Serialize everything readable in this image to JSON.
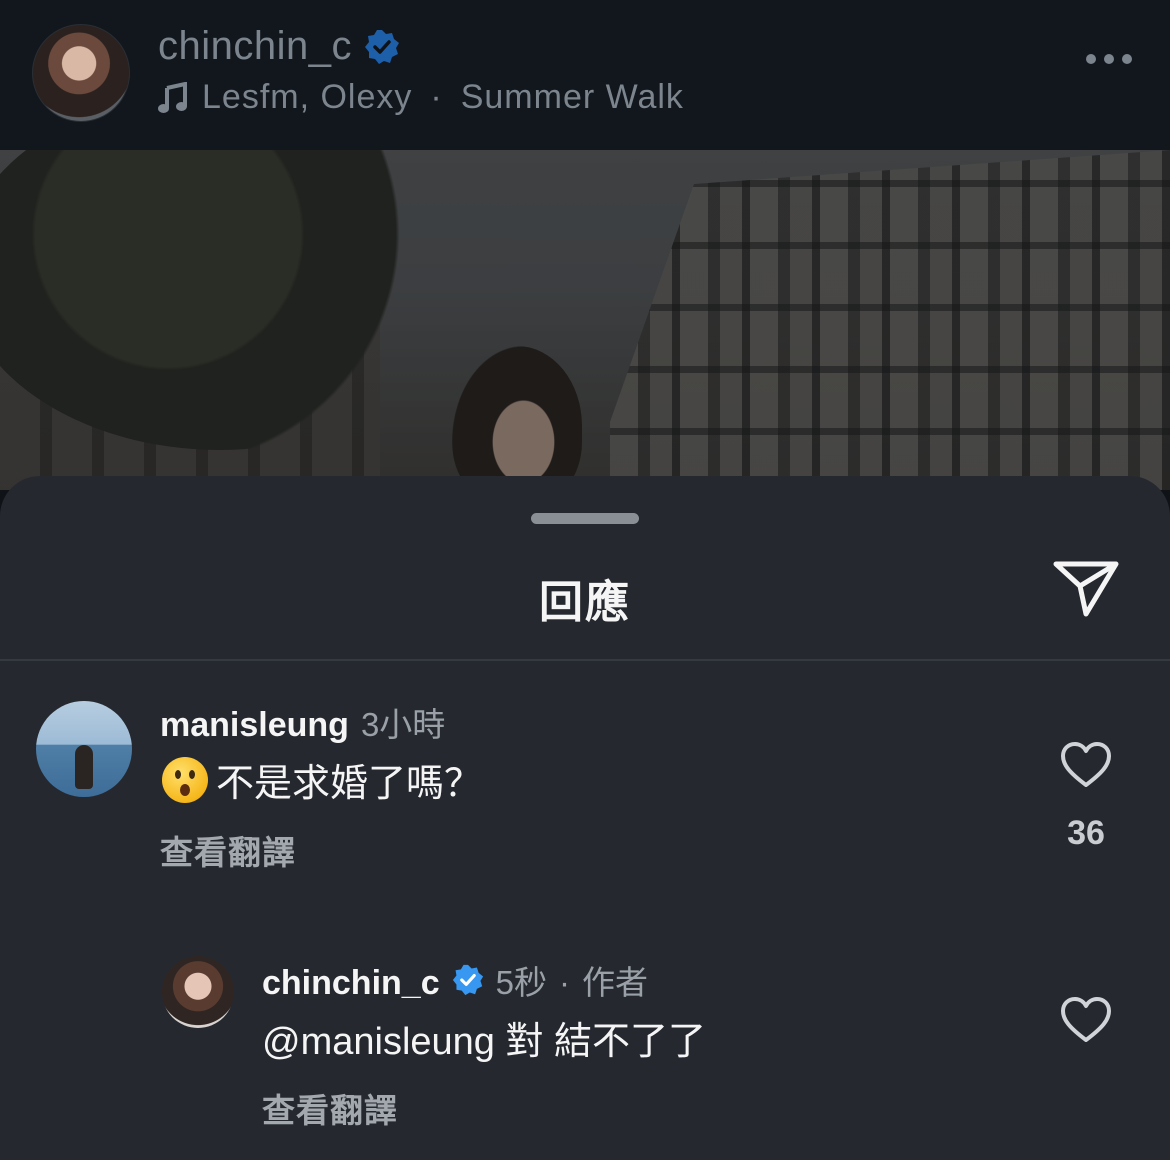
{
  "header": {
    "username": "chinchin_c",
    "music_artist": "Lesfm, Olexy",
    "music_separator": "·",
    "music_title": "Summer Walk",
    "icons": [
      "music-note-icon",
      "verified-badge-icon",
      "more-options-icon"
    ]
  },
  "sheet": {
    "title": "回應",
    "send_icon": "paper-plane-icon"
  },
  "comments": [
    {
      "username": "manisleung",
      "time": "3小時",
      "emoji": "😮",
      "text": "不是求婚了嗎？",
      "translate_label": "查看翻譯",
      "likes": "36"
    },
    {
      "username": "chinchin_c",
      "time": "5秒",
      "separator": "·",
      "author_label": "作者",
      "text": "@manisleung 對 結不了了",
      "translate_label": "查看翻譯"
    }
  ],
  "colors": {
    "verified": "#3897f0",
    "sheet_bg": "#25292f",
    "top_bg": "#12171d"
  }
}
